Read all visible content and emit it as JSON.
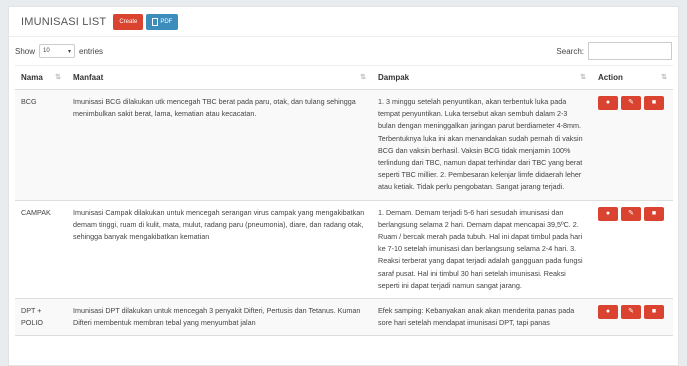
{
  "header": {
    "title": "IMUNISASI LIST",
    "create_label": "Create",
    "pdf_label": "PDF"
  },
  "controls": {
    "show_label": "Show",
    "entries_value": "10",
    "entries_label": "entries",
    "search_label": "Search:"
  },
  "table": {
    "columns": [
      "Nama",
      "Manfaat",
      "Dampak",
      "Action"
    ],
    "rows": [
      {
        "nama": "BCG",
        "manfaat": "Imunisasi BCG dilakukan utk mencegah TBC berat pada paru, otak, dan tulang sehingga menimbulkan sakit berat, lama, kematian atau kecacatan.",
        "dampak": "1. 3 minggu setelah penyuntikan, akan terbentuk luka pada tempat penyuntikan. Luka tersebut akan sembuh dalam 2-3 bulan dengan meninggalkan jaringan parut berdiameter 4-8mm. Terbentuknya luka ini akan menandakan sudah pernah di vaksin BCG dan vaksin berhasil. Vaksin BCG tidak menjamin 100% terlindung dari TBC, namun dapat terhindar dari TBC yang berat seperti TBC millier. 2. Pembesaran kelenjar limfe didaerah leher atau ketiak. Tidak perlu pengobatan. Sangat jarang terjadi."
      },
      {
        "nama": "CAMPAK",
        "manfaat": "Imunisasi Campak dilakukan untuk mencegah serangan virus campak yang mengakibatkan demam tinggi, ruam di kulit, mata, mulut, radang paru (pneumonia), diare, dan radang otak, sehingga banyak mengakibatkan kematian",
        "dampak": "1. Demam. Demam terjadi 5-6 hari sesudah imunisasi dan berlangsung selama 2 hari. Demam dapat mencapai 39,5ºC. 2. Ruam / bercak merah pada tubuh. Hal ini dapat timbul pada hari ke 7-10 setelah imunisasi dan berlangsung selama 2-4 hari. 3. Reaksi terberat yang dapat terjadi adalah gangguan pada fungsi saraf pusat. Hal ini timbul 30 hari setelah imunisasi. Reaksi seperti ini dapat terjadi namun sangat jarang."
      },
      {
        "nama": "DPT + POLIO",
        "manfaat": "Imunisasi DPT dilakukan untuk mencegah 3 penyakit Difteri, Pertusis dan Tetanus. Kuman Difteri membentuk membran tebal yang menyumbat jalan",
        "dampak": "Efek samping: Kebanyakan anak akan menderita panas pada sore hari setelah mendapat imunisasi DPT, tapi panas"
      }
    ]
  }
}
